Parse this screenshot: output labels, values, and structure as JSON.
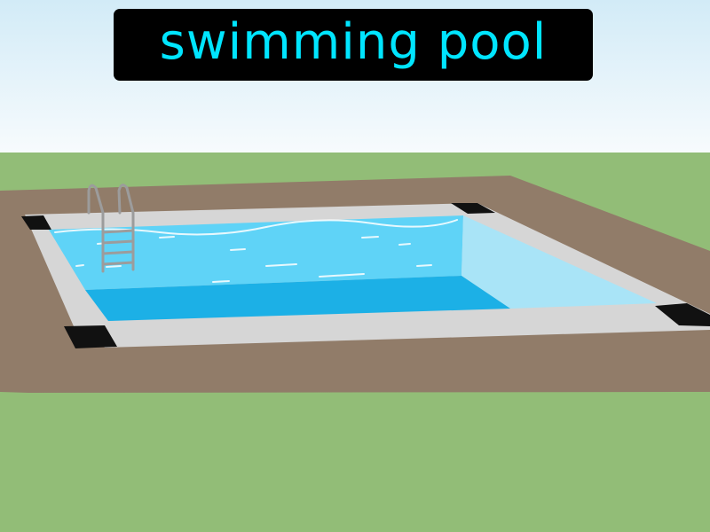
{
  "caption": {
    "text": "swimming pool"
  },
  "scene": {
    "subject": "swimming-pool",
    "colors": {
      "sky_top": "#d2ebf7",
      "sky_bottom": "#f7fbfd",
      "grass": "#92bd77",
      "soil": "#917c69",
      "deck": "#d6d6d6",
      "corner": "#111111",
      "water_floor": "#1cb0e6",
      "water_surface": "#5fd3f7",
      "water_right_wall": "#a9e4f7",
      "ladder": "#9c9c9c",
      "caption_text": "#00e5ff",
      "caption_box": "#000000"
    }
  }
}
